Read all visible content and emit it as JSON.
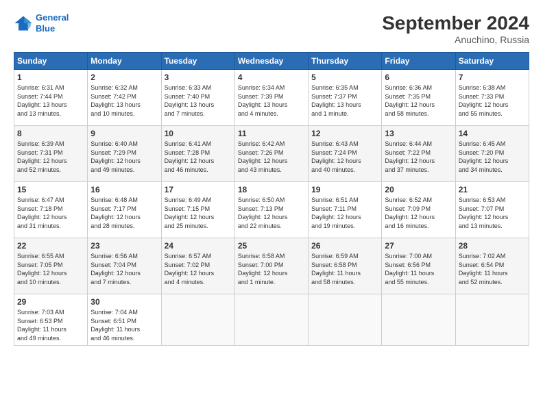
{
  "header": {
    "logo_line1": "General",
    "logo_line2": "Blue",
    "month": "September 2024",
    "location": "Anuchino, Russia"
  },
  "weekdays": [
    "Sunday",
    "Monday",
    "Tuesday",
    "Wednesday",
    "Thursday",
    "Friday",
    "Saturday"
  ],
  "weeks": [
    [
      {
        "day": "1",
        "info": "Sunrise: 6:31 AM\nSunset: 7:44 PM\nDaylight: 13 hours\nand 13 minutes."
      },
      {
        "day": "2",
        "info": "Sunrise: 6:32 AM\nSunset: 7:42 PM\nDaylight: 13 hours\nand 10 minutes."
      },
      {
        "day": "3",
        "info": "Sunrise: 6:33 AM\nSunset: 7:40 PM\nDaylight: 13 hours\nand 7 minutes."
      },
      {
        "day": "4",
        "info": "Sunrise: 6:34 AM\nSunset: 7:39 PM\nDaylight: 13 hours\nand 4 minutes."
      },
      {
        "day": "5",
        "info": "Sunrise: 6:35 AM\nSunset: 7:37 PM\nDaylight: 13 hours\nand 1 minute."
      },
      {
        "day": "6",
        "info": "Sunrise: 6:36 AM\nSunset: 7:35 PM\nDaylight: 12 hours\nand 58 minutes."
      },
      {
        "day": "7",
        "info": "Sunrise: 6:38 AM\nSunset: 7:33 PM\nDaylight: 12 hours\nand 55 minutes."
      }
    ],
    [
      {
        "day": "8",
        "info": "Sunrise: 6:39 AM\nSunset: 7:31 PM\nDaylight: 12 hours\nand 52 minutes."
      },
      {
        "day": "9",
        "info": "Sunrise: 6:40 AM\nSunset: 7:29 PM\nDaylight: 12 hours\nand 49 minutes."
      },
      {
        "day": "10",
        "info": "Sunrise: 6:41 AM\nSunset: 7:28 PM\nDaylight: 12 hours\nand 46 minutes."
      },
      {
        "day": "11",
        "info": "Sunrise: 6:42 AM\nSunset: 7:26 PM\nDaylight: 12 hours\nand 43 minutes."
      },
      {
        "day": "12",
        "info": "Sunrise: 6:43 AM\nSunset: 7:24 PM\nDaylight: 12 hours\nand 40 minutes."
      },
      {
        "day": "13",
        "info": "Sunrise: 6:44 AM\nSunset: 7:22 PM\nDaylight: 12 hours\nand 37 minutes."
      },
      {
        "day": "14",
        "info": "Sunrise: 6:45 AM\nSunset: 7:20 PM\nDaylight: 12 hours\nand 34 minutes."
      }
    ],
    [
      {
        "day": "15",
        "info": "Sunrise: 6:47 AM\nSunset: 7:18 PM\nDaylight: 12 hours\nand 31 minutes."
      },
      {
        "day": "16",
        "info": "Sunrise: 6:48 AM\nSunset: 7:17 PM\nDaylight: 12 hours\nand 28 minutes."
      },
      {
        "day": "17",
        "info": "Sunrise: 6:49 AM\nSunset: 7:15 PM\nDaylight: 12 hours\nand 25 minutes."
      },
      {
        "day": "18",
        "info": "Sunrise: 6:50 AM\nSunset: 7:13 PM\nDaylight: 12 hours\nand 22 minutes."
      },
      {
        "day": "19",
        "info": "Sunrise: 6:51 AM\nSunset: 7:11 PM\nDaylight: 12 hours\nand 19 minutes."
      },
      {
        "day": "20",
        "info": "Sunrise: 6:52 AM\nSunset: 7:09 PM\nDaylight: 12 hours\nand 16 minutes."
      },
      {
        "day": "21",
        "info": "Sunrise: 6:53 AM\nSunset: 7:07 PM\nDaylight: 12 hours\nand 13 minutes."
      }
    ],
    [
      {
        "day": "22",
        "info": "Sunrise: 6:55 AM\nSunset: 7:05 PM\nDaylight: 12 hours\nand 10 minutes."
      },
      {
        "day": "23",
        "info": "Sunrise: 6:56 AM\nSunset: 7:04 PM\nDaylight: 12 hours\nand 7 minutes."
      },
      {
        "day": "24",
        "info": "Sunrise: 6:57 AM\nSunset: 7:02 PM\nDaylight: 12 hours\nand 4 minutes."
      },
      {
        "day": "25",
        "info": "Sunrise: 6:58 AM\nSunset: 7:00 PM\nDaylight: 12 hours\nand 1 minute."
      },
      {
        "day": "26",
        "info": "Sunrise: 6:59 AM\nSunset: 6:58 PM\nDaylight: 11 hours\nand 58 minutes."
      },
      {
        "day": "27",
        "info": "Sunrise: 7:00 AM\nSunset: 6:56 PM\nDaylight: 11 hours\nand 55 minutes."
      },
      {
        "day": "28",
        "info": "Sunrise: 7:02 AM\nSunset: 6:54 PM\nDaylight: 11 hours\nand 52 minutes."
      }
    ],
    [
      {
        "day": "29",
        "info": "Sunrise: 7:03 AM\nSunset: 6:53 PM\nDaylight: 11 hours\nand 49 minutes."
      },
      {
        "day": "30",
        "info": "Sunrise: 7:04 AM\nSunset: 6:51 PM\nDaylight: 11 hours\nand 46 minutes."
      },
      {
        "day": "",
        "info": ""
      },
      {
        "day": "",
        "info": ""
      },
      {
        "day": "",
        "info": ""
      },
      {
        "day": "",
        "info": ""
      },
      {
        "day": "",
        "info": ""
      }
    ]
  ]
}
